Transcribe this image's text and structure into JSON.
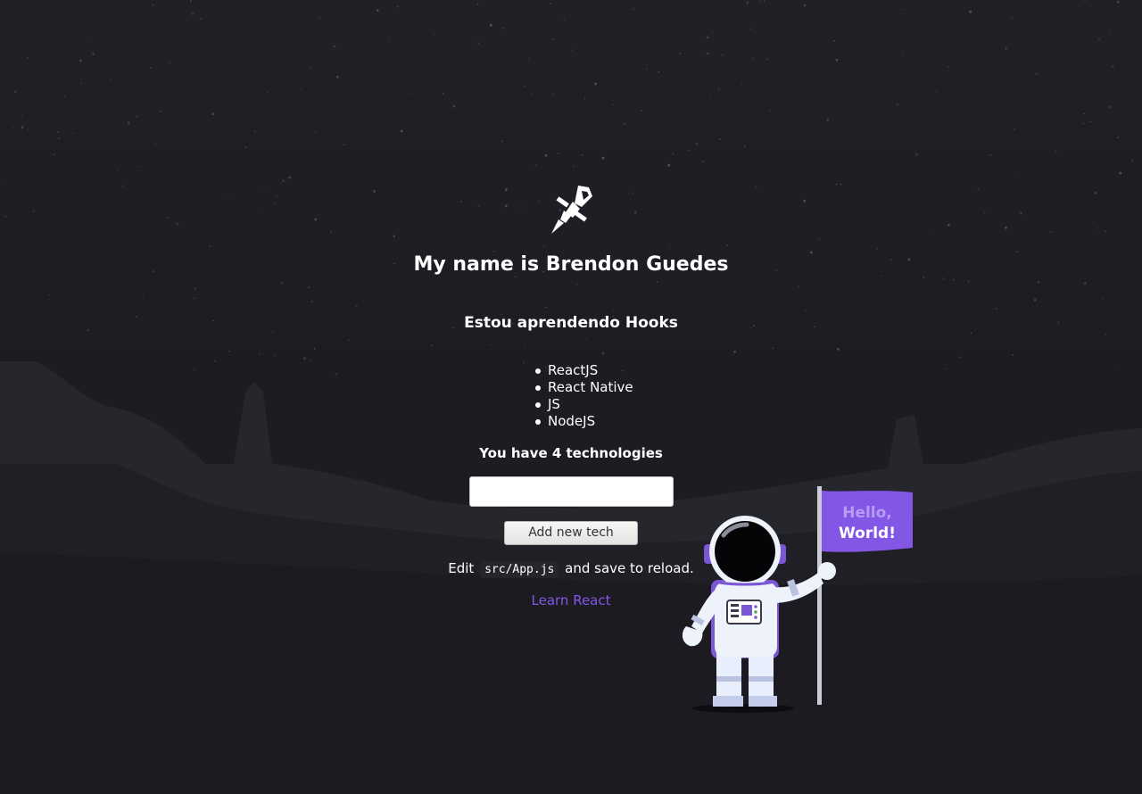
{
  "header": {
    "title": "My name is Brendon Guedes",
    "subtitle": "Estou aprendendo Hooks"
  },
  "techs": {
    "items": [
      "ReactJS",
      "React Native",
      "JS",
      "NodeJS"
    ],
    "count_text": "You have 4 technologies"
  },
  "form": {
    "input_value": "",
    "add_button_label": "Add new tech"
  },
  "footer": {
    "edit_prefix": "Edit",
    "edit_code": "src/App.js",
    "edit_suffix": "and save to reload.",
    "learn_link_label": "Learn React"
  },
  "flag": {
    "line1": "Hello,",
    "line2": "World!"
  },
  "icons": {
    "logo": "rocket-icon"
  },
  "colors": {
    "background": "#1b1b21",
    "accent": "#8257e5",
    "text": "#ffffff"
  }
}
